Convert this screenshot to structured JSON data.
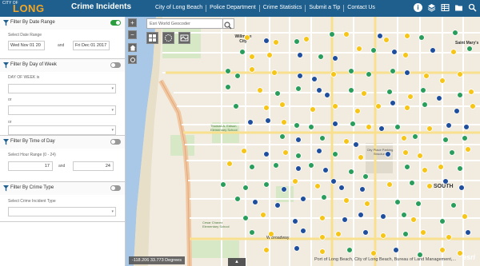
{
  "header": {
    "logo_city": "CITY OF",
    "logo_lb": "LONG BEACH",
    "title": "Crime Incidents",
    "nav": [
      "City of Long Beach",
      "Police Department",
      "Crime Statistics",
      "Submit a Tip",
      "Contact Us"
    ]
  },
  "filters": {
    "date": {
      "title": "Filter By Date Range",
      "enabled": true,
      "range_label": "Select Date Range",
      "start": "Wed Nov 01 20",
      "and": "and",
      "end": "Fri Dec 01 2017"
    },
    "dow": {
      "title": "Filter By Day of Week",
      "enabled": false,
      "label": "DAY OF WEEK is",
      "or1": "or",
      "or2": "or"
    },
    "tod": {
      "title": "Filter By Time of Day",
      "enabled": false,
      "label": "Select Hour Range (0 - 24)",
      "from": "17",
      "and": "and",
      "to": "24"
    },
    "type": {
      "title": "Filter By Crime Type",
      "enabled": false,
      "label": "Select Crime Incident Type"
    }
  },
  "map": {
    "search_placeholder": "Esri World Geocoder",
    "coords": "-118.206 33.773 Degrees",
    "attribution": "Port of Long Beach, City of Long Beach, Bureau of Land Management,...",
    "logo": "esri",
    "labels": {
      "willmore": "Willmore City",
      "saint_marys": "Saint Mary's",
      "south": "SOUTH",
      "thomas_edison": "Thomas A. Edison Elementary School",
      "city_place": "City Place Parking Structure",
      "cesar": "Cesar Chavez Elementary School",
      "w_broadway": "W Broadway"
    }
  },
  "colors": {
    "header": "#1e5f8e",
    "accent": "#f5a623",
    "green_marker": "#2a9d5c",
    "blue_marker": "#1f4e9c",
    "yellow_marker": "#f5c518",
    "water": "#a9c8e8"
  }
}
